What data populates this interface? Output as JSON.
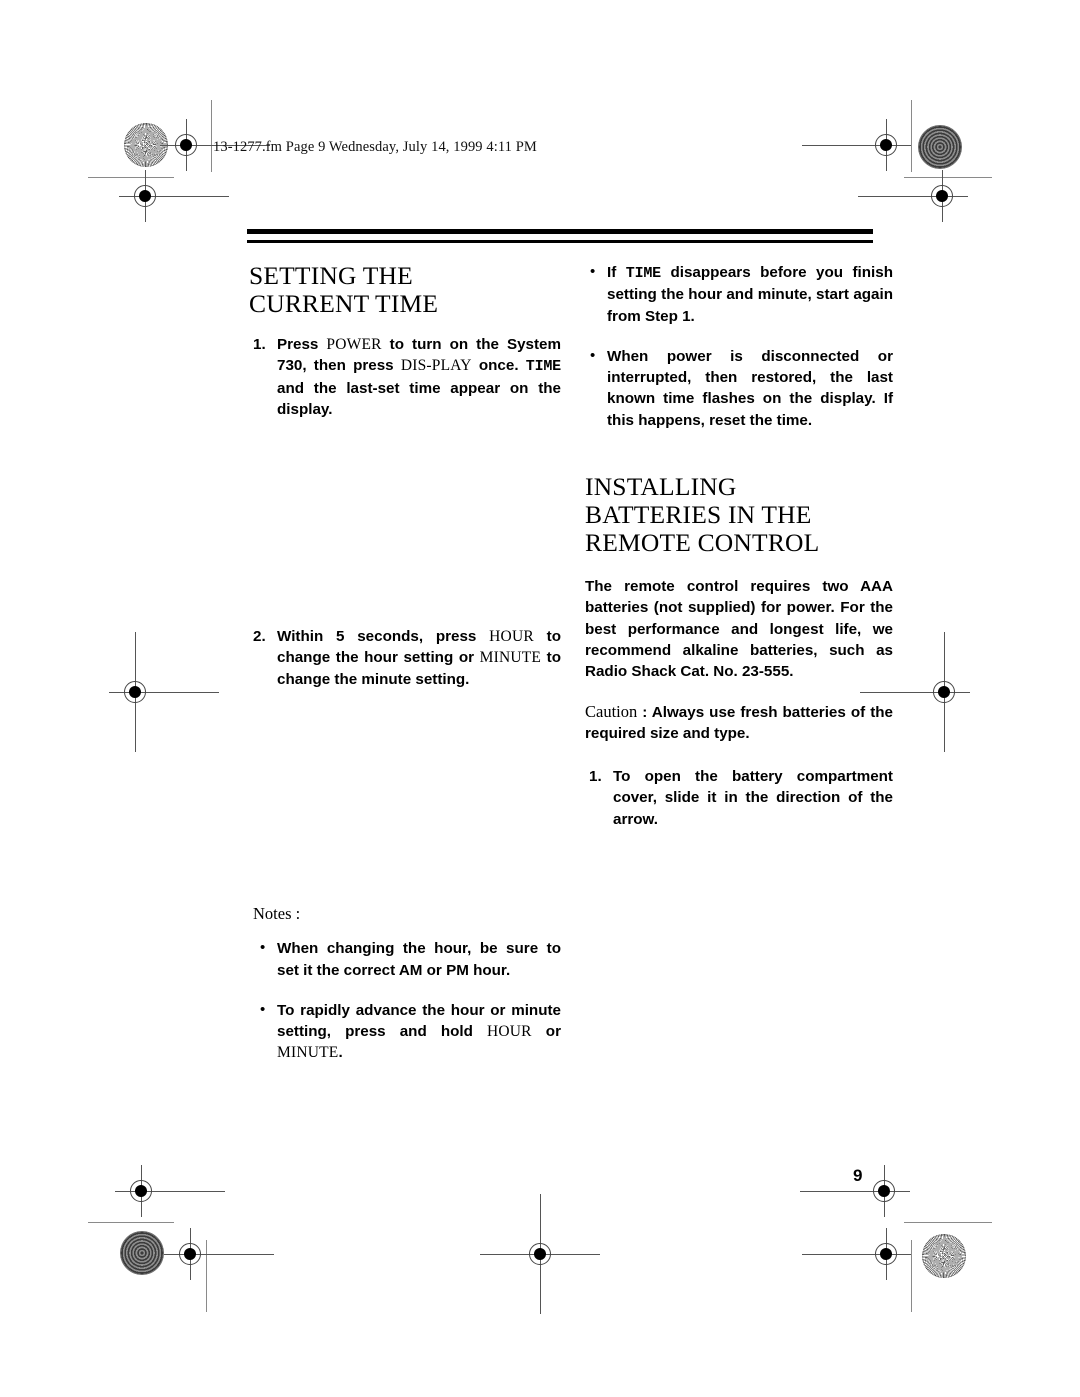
{
  "document": {
    "running_header": "13-1277.fm  Page 9  Wednesday, July 14, 1999  4:11 PM",
    "page_number": "9"
  },
  "left_column": {
    "section_title_line1": "SETTING THE",
    "section_title_line2": "CURRENT TIME",
    "steps": [
      {
        "number": "1.",
        "part1": "Press ",
        "key1": "POWER",
        "part2": " to turn on the System 730, then press ",
        "key2": "DIS-PLAY",
        "part3": " once. ",
        "lcd1": "TIME",
        "part4": " and the last-set time appear on the display."
      },
      {
        "number": "2.",
        "part1": "Within 5 seconds, press ",
        "key1": "HOUR",
        "part2": " to change the hour setting or ",
        "key2": "MINUTE",
        "part3": " to change the minute setting."
      }
    ],
    "notes_label": "Notes :",
    "notes": [
      {
        "bullet": "•",
        "part1": "When changing the hour, be sure to set it the correct AM or PM hour."
      },
      {
        "bullet": "•",
        "part1": "To rapidly advance the hour or minute setting, press and hold ",
        "key1": "HOUR",
        "part2": " or ",
        "key2": "MINUTE",
        "part3": "."
      }
    ]
  },
  "right_column": {
    "bullets": [
      {
        "bullet": "•",
        "part1": "If ",
        "lcd1": "TIME",
        "part2": " disappears before you finish setting the hour and minute, start again from Step 1."
      },
      {
        "bullet": "•",
        "part1": "When power is disconnected or interrupted, then restored, the last known time flashes on the display. If this happens, reset the time."
      }
    ],
    "section_title_line1": "INSTALLING",
    "section_title_line2": "BATTERIES IN THE",
    "section_title_line3": "REMOTE CONTROL",
    "body_paragraph": "The remote control requires two AAA batteries (not supplied) for power. For the best performance and longest life, we recommend alkaline batteries, such as Radio Shack Cat. No. 23-555.",
    "caution_label": "Caution",
    "caution_separator": " : ",
    "caution_text": "Always use fresh batteries of the required size and type.",
    "steps": [
      {
        "number": "1.",
        "part1": "To open the battery compartment cover, slide it in the direction of the arrow."
      }
    ]
  },
  "colors": {
    "ink": "#000000",
    "paper": "#ffffff",
    "regmark_grey": "#555555",
    "trimline_grey": "#8a8a8a"
  }
}
